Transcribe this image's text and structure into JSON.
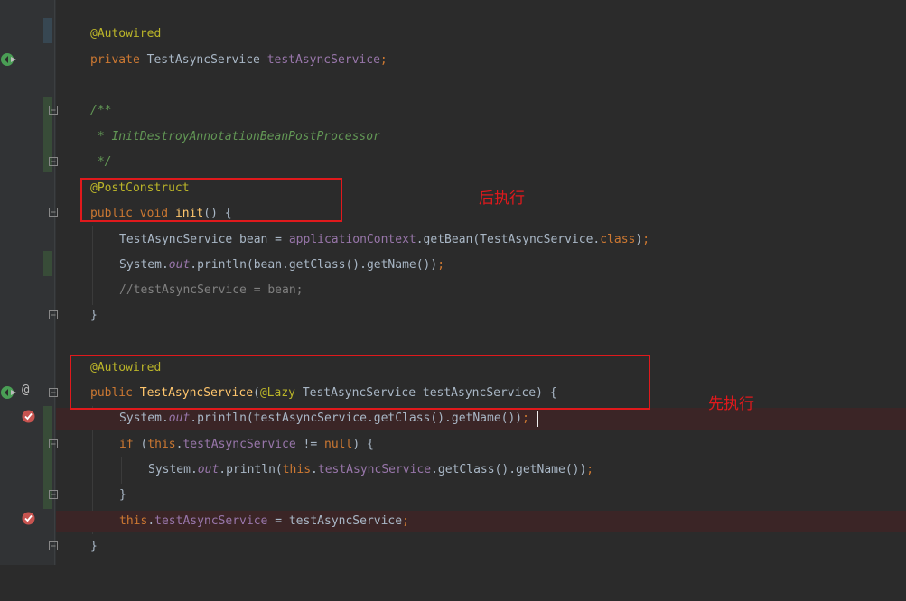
{
  "lines": {
    "l1": {
      "a": "@Autowired"
    },
    "l2": {
      "kw": "private",
      "type": " TestAsyncService ",
      "field": "testAsyncService",
      "semi": ";"
    },
    "l3": {
      "doc": "/**"
    },
    "l4": {
      "doc": " * InitDestroyAnnotationBeanPostProcessor"
    },
    "l5": {
      "doc": " */"
    },
    "l6": {
      "a": "@PostConstruct"
    },
    "l7": {
      "kw1": "public",
      "kw2": " void ",
      "m": "init",
      "rest": "() {"
    },
    "l8": {
      "t1": "TestAsyncService bean = ",
      "f": "applicationContext",
      "t2": ".getBean(TestAsyncService.",
      "k": "class",
      "t3": ")",
      "semi": ";"
    },
    "l9": {
      "t1": "System.",
      "f": "out",
      "t2": ".println(bean.getClass().getName())",
      "semi": ";"
    },
    "l10": {
      "c": "//testAsyncService = bean;"
    },
    "l11": {
      "t": "}"
    },
    "l12": {
      "a": "@Autowired"
    },
    "l13": {
      "kw": "public",
      "m": " TestAsyncService",
      "p": "(",
      "a": "@Lazy",
      "rest": " TestAsyncService testAsyncService) {"
    },
    "l14": {
      "t1": "System.",
      "f": "out",
      "t2": ".println(testAsyncService.getClass().getName())",
      "semi": ";"
    },
    "l15": {
      "kw": "if",
      "t1": " (",
      "kw2": "this",
      "t2": ".",
      "f": "testAsyncService",
      "t3": " != ",
      "kw3": "null",
      "t4": ") {"
    },
    "l16": {
      "t1": "System.",
      "f": "out",
      "t2": ".println(",
      "kw": "this",
      "t3": ".",
      "f2": "testAsyncService",
      "t4": ".getClass().getName())",
      "semi": ";"
    },
    "l17": {
      "t": "}"
    },
    "l18": {
      "kw": "this",
      "t1": ".",
      "f": "testAsyncService",
      "t2": " = testAsyncService",
      "semi": ";"
    },
    "l19": {
      "t": "}"
    }
  },
  "annotations": {
    "post_note": "后执行",
    "ctor_note": "先执行"
  },
  "colors": {
    "background": "#2b2b2b",
    "keyword": "#cc7832",
    "annotation": "#bbb529",
    "field": "#9876aa",
    "doc": "#629755",
    "method": "#ffc66d",
    "highlight_box": "#e0191c"
  },
  "icons": [
    "spring-bean-icon",
    "breakpoint-icon",
    "fold-icon",
    "at-icon"
  ]
}
